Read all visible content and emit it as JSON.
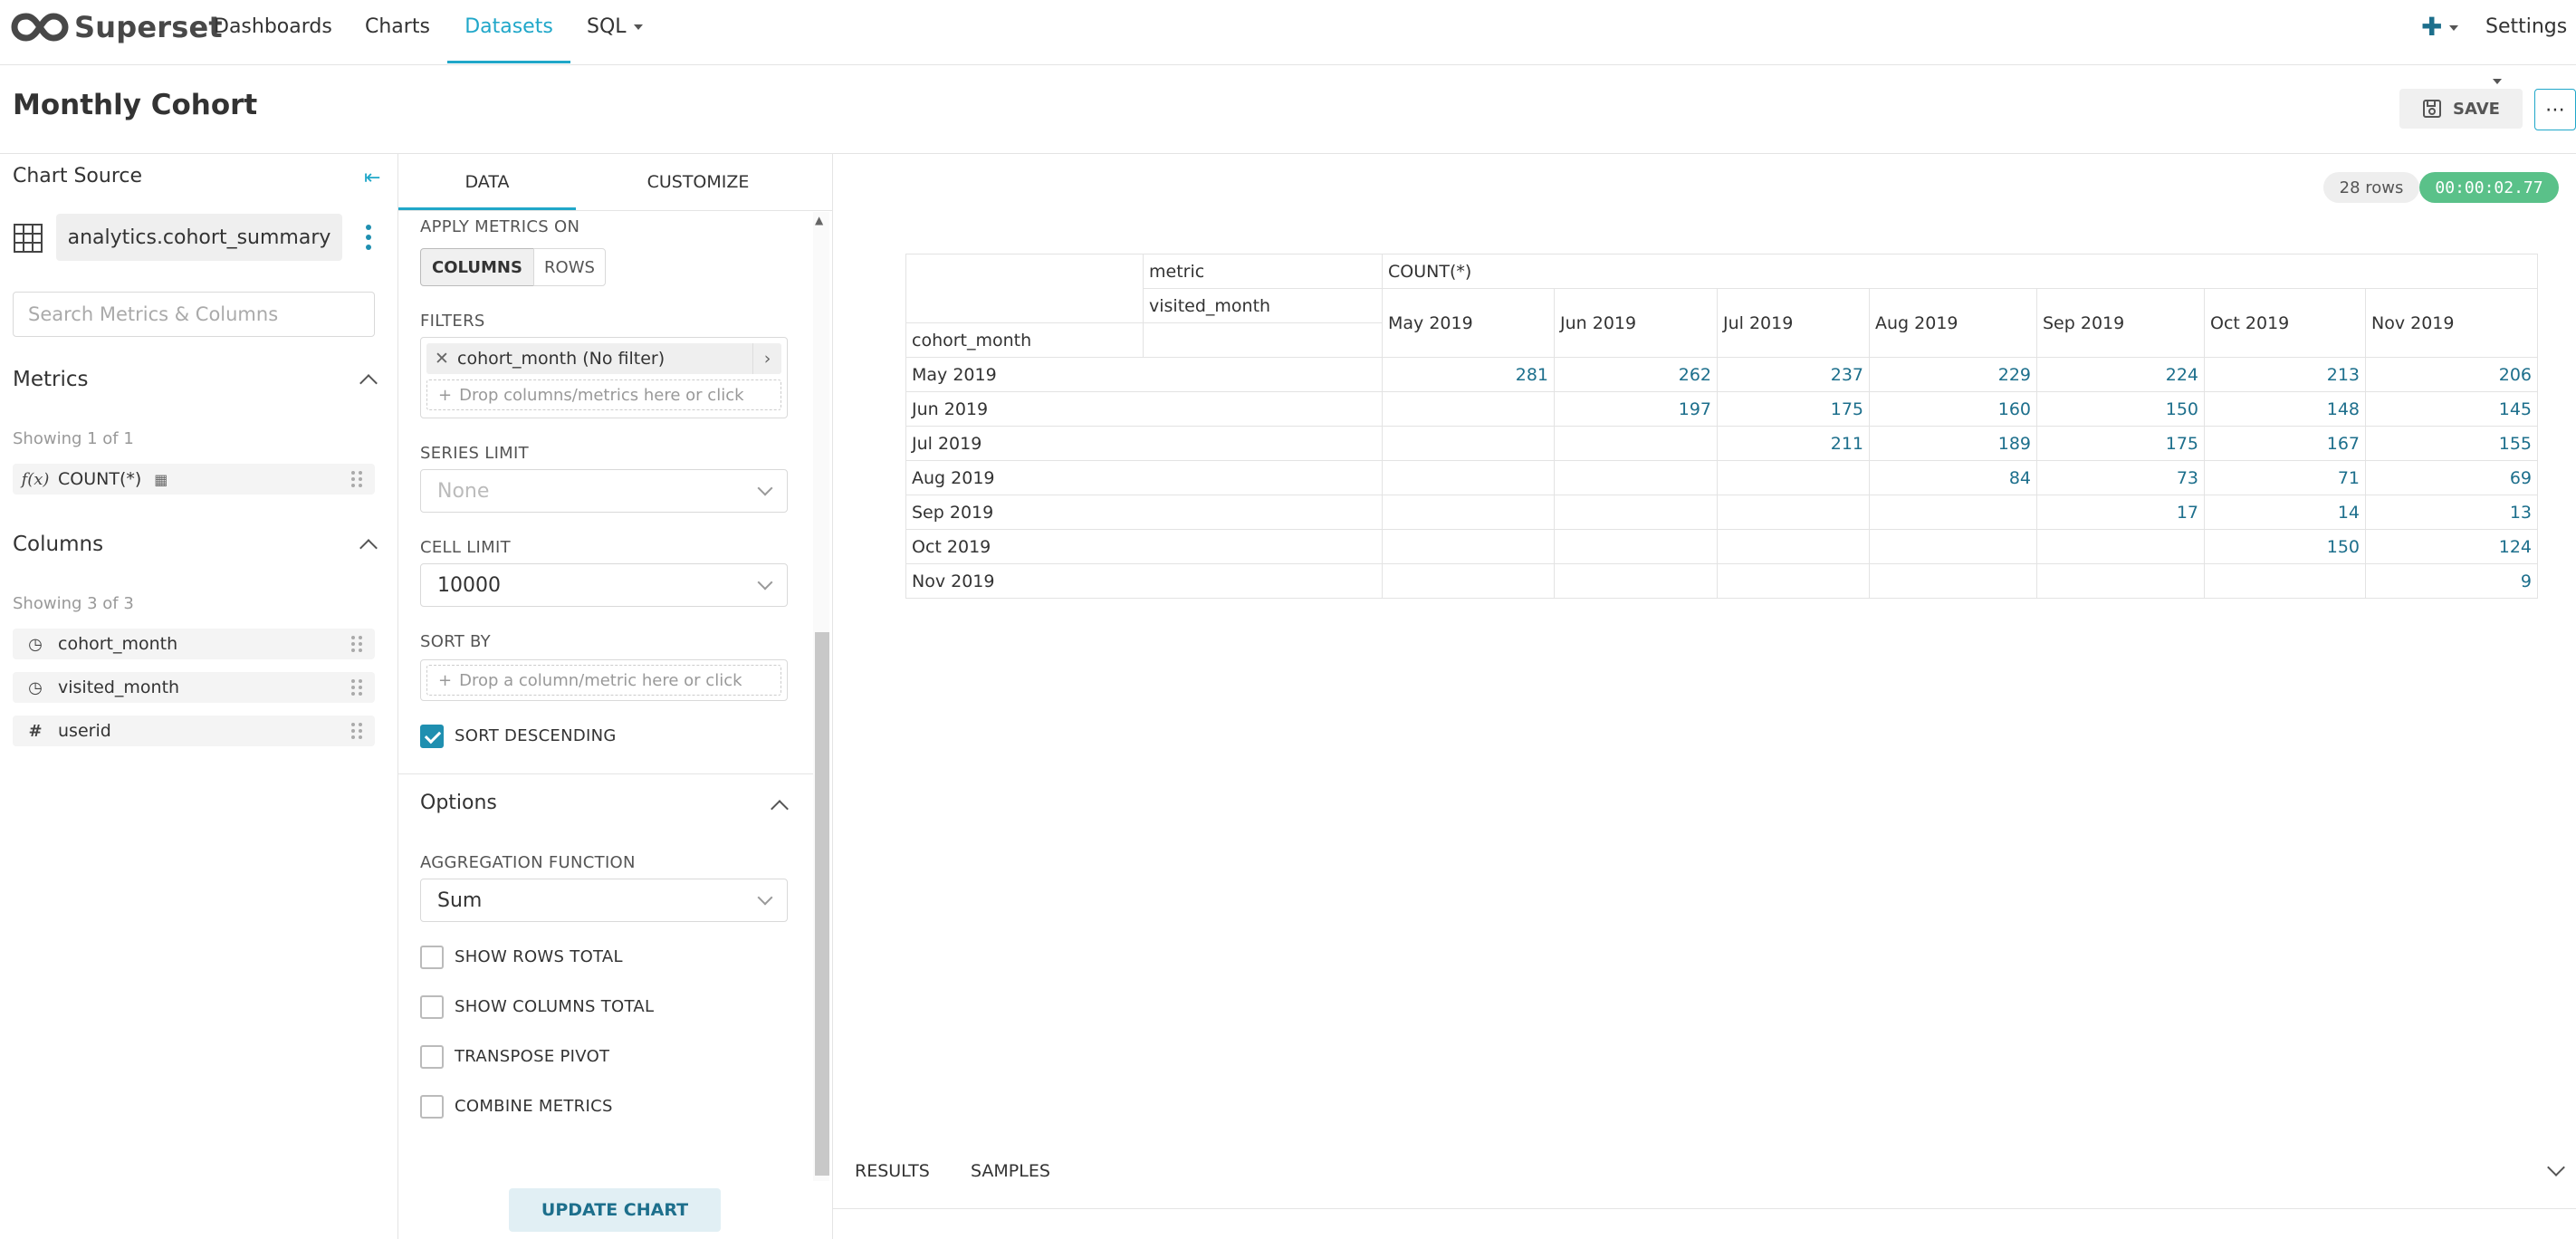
{
  "nav": {
    "brand": "Superset",
    "items": [
      "Dashboards",
      "Charts",
      "Datasets",
      "SQL"
    ],
    "active": "Datasets",
    "settings": "Settings"
  },
  "header": {
    "title": "Monthly Cohort",
    "save_label": "SAVE"
  },
  "source": {
    "title": "Chart Source",
    "dataset": "analytics.cohort_summary",
    "search_placeholder": "Search Metrics & Columns",
    "metrics_title": "Metrics",
    "metrics_showing": "Showing 1 of 1",
    "metrics": [
      {
        "icon": "f(x)",
        "label": "COUNT(*)"
      }
    ],
    "columns_title": "Columns",
    "columns_showing": "Showing 3 of 3",
    "columns": [
      {
        "icon": "clock-icon",
        "label": "cohort_month"
      },
      {
        "icon": "clock-icon",
        "label": "visited_month"
      },
      {
        "icon": "hash-icon",
        "label": "userid"
      }
    ]
  },
  "controls": {
    "tabs": [
      "DATA",
      "CUSTOMIZE"
    ],
    "apply_metrics_on": "APPLY METRICS ON",
    "seg_columns": "COLUMNS",
    "seg_rows": "ROWS",
    "filters_label": "FILTERS",
    "filter_pill": "cohort_month (No filter)",
    "filter_drop": "Drop columns/metrics here or click",
    "series_limit_label": "SERIES LIMIT",
    "series_limit_value": "None",
    "cell_limit_label": "CELL LIMIT",
    "cell_limit_value": "10000",
    "sort_by_label": "SORT BY",
    "sort_by_drop": "Drop a column/metric here or click",
    "sort_desc_label": "SORT DESCENDING",
    "options_title": "Options",
    "agg_label": "AGGREGATION FUNCTION",
    "agg_value": "Sum",
    "show_rows_total": "SHOW ROWS TOTAL",
    "show_cols_total": "SHOW COLUMNS TOTAL",
    "transpose_pivot": "TRANSPOSE PIVOT",
    "combine_metrics": "COMBINE METRICS",
    "update_label": "UPDATE CHART"
  },
  "status": {
    "rows": "28 rows",
    "time": "00:00:02.77"
  },
  "pivot": {
    "metric_label": "metric",
    "metric_value": "COUNT(*)",
    "col_dim": "visited_month",
    "row_dim": "cohort_month",
    "months": [
      "May 2019",
      "Jun 2019",
      "Jul 2019",
      "Aug 2019",
      "Sep 2019",
      "Oct 2019",
      "Nov 2019"
    ],
    "rows": [
      [
        "281",
        "262",
        "237",
        "229",
        "224",
        "213",
        "206"
      ],
      [
        "",
        "197",
        "175",
        "160",
        "150",
        "148",
        "145"
      ],
      [
        "",
        "",
        "211",
        "189",
        "175",
        "167",
        "155"
      ],
      [
        "",
        "",
        "",
        "84",
        "73",
        "71",
        "69"
      ],
      [
        "",
        "",
        "",
        "",
        "17",
        "14",
        "13"
      ],
      [
        "",
        "",
        "",
        "",
        "",
        "150",
        "124"
      ],
      [
        "",
        "",
        "",
        "",
        "",
        "",
        "9"
      ]
    ]
  },
  "results_tabs": [
    "RESULTS",
    "SAMPLES"
  ]
}
